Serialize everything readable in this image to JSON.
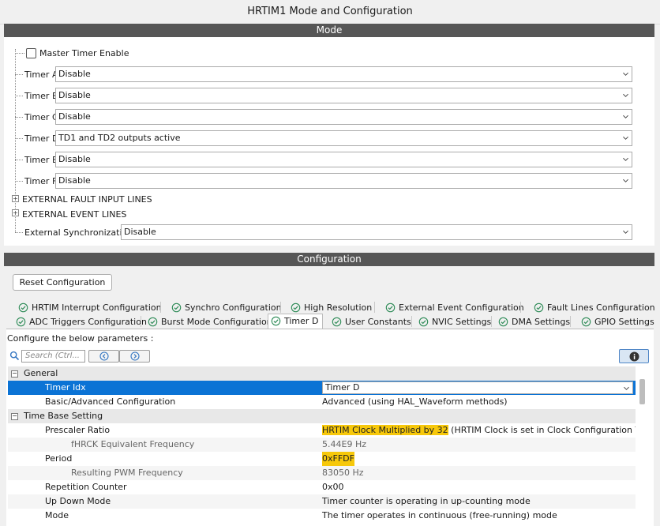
{
  "window": {
    "title": "HRTIM1 Mode and Configuration"
  },
  "mode": {
    "header": "Mode",
    "master_timer_label": "Master Timer Enable",
    "master_timer_checked": false,
    "timers": [
      {
        "label": "Timer A",
        "value": "Disable"
      },
      {
        "label": "Timer B",
        "value": "Disable"
      },
      {
        "label": "Timer C",
        "value": "Disable"
      },
      {
        "label": "Timer D",
        "value": "TD1 and TD2 outputs active"
      },
      {
        "label": "Timer E",
        "value": "Disable"
      },
      {
        "label": "Timer F",
        "value": "Disable"
      }
    ],
    "fault_lines_label": "EXTERNAL FAULT INPUT LINES",
    "event_lines_label": "EXTERNAL EVENT LINES",
    "ext_sync": {
      "label": "External Synchronization",
      "value": "Disable"
    }
  },
  "config": {
    "header": "Configuration",
    "reset_label": "Reset Configuration",
    "tabs_row1": [
      "HRTIM Interrupt Configuration",
      "Synchro Configuration",
      "High Resolution",
      "External Event Configuration",
      "Fault Lines Configuration"
    ],
    "tabs_row2": [
      "ADC Triggers Configuration",
      "Burst Mode Configuration",
      "Timer D",
      "User Constants",
      "NVIC Settings",
      "DMA Settings",
      "GPIO Settings"
    ],
    "active_tab": "Timer D",
    "params_heading": "Configure the below parameters :",
    "search_placeholder": "Search (Ctrl...",
    "groups": {
      "general": "General",
      "time_base": "Time Base Setting"
    },
    "params": {
      "timer_idx": {
        "name": "Timer Idx",
        "value": "Timer D"
      },
      "basic_adv": {
        "name": "Basic/Advanced Configuration",
        "value": "Advanced (using HAL_Waveform methods)"
      },
      "prescaler": {
        "name": "Prescaler Ratio",
        "value_highlight": "HRTIM Clock Multiplied by 32",
        "value_rest": " (HRTIM Clock is set in Clock Configuration Tab wit..."
      },
      "fhrck": {
        "name": "fHRCK Equivalent Frequency",
        "value": "5.44E9 Hz"
      },
      "period": {
        "name": "Period",
        "value": "0xFFDF"
      },
      "pwm_freq": {
        "name": "Resulting PWM Frequency",
        "value": "83050 Hz"
      },
      "rep_counter": {
        "name": "Repetition Counter",
        "value": "0x00"
      },
      "up_down": {
        "name": "Up Down Mode",
        "value": "Timer counter is operating in up-counting mode"
      },
      "mode": {
        "name": "Mode",
        "value": "The timer operates in continuous (free-running) mode"
      }
    }
  },
  "colors": {
    "selection": "#0b73d5",
    "highlight": "#f7c80a",
    "section_bar": "#565656",
    "check_green": "#2e8b57"
  }
}
